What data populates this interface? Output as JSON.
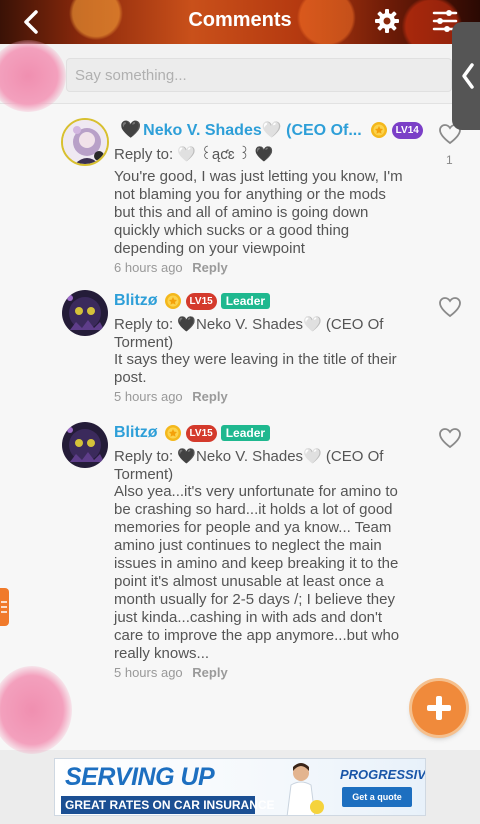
{
  "header": {
    "title": "Comments"
  },
  "composer": {
    "placeholder": "Say something..."
  },
  "comments": [
    {
      "author_prefix": "🖤",
      "author": "Neko V. Shades🤍 (CEO Of...",
      "level": "LV14",
      "reply_to": "Reply to: 🤍 ꒰ąƈɛ ꒱ 🖤",
      "text_lines": [
        "You're good, I was just letting you know, I'm",
        "not blaming you for anything or the mods",
        "but this and all of amino is going down",
        "quickly which sucks or a good thing",
        "depending on your viewpoint"
      ],
      "time": "6 hours ago",
      "reply_label": "Reply",
      "likes": "1"
    },
    {
      "author": "Blitzø",
      "level": "LV15",
      "role": "Leader",
      "reply_to_lines": [
        "Reply to: 🖤Neko V. Shades🤍 (CEO Of",
        "Torment)"
      ],
      "text_lines": [
        "It says they were leaving in the title of their",
        "post."
      ],
      "time": "5 hours ago",
      "reply_label": "Reply"
    },
    {
      "author": "Blitzø",
      "level": "LV15",
      "role": "Leader",
      "reply_to_lines": [
        "Reply to: 🖤Neko V. Shades🤍 (CEO Of",
        "Torment)"
      ],
      "text_lines": [
        "Also yea...it's very unfortunate for amino to",
        "be crashing so hard...it holds a lot of good",
        "memories for people and ya know... Team",
        "amino just continues to neglect the main",
        "issues in amino and keep breaking it to the",
        "point it's almost unusable at least once a",
        "month usually for 2-5 days /; I believe they",
        "just kinda...cashing in with ads and don't",
        "care to improve the app anymore...but who",
        "really knows..."
      ],
      "time": "5 hours ago",
      "reply_label": "Reply"
    }
  ],
  "ad": {
    "headline": "SERVING UP",
    "subline": "GREAT RATES ON CAR INSURANCE",
    "brand": "PROGRESSIVE",
    "cta": "Get a quote"
  },
  "colors": {
    "name_blue": "#2e9fd8",
    "leader_green": "#1fb88f",
    "fab_orange": "#f08a3b"
  },
  "icons": [
    "back-chevron-icon",
    "gear-icon",
    "filter-sliders-icon",
    "heart-icon",
    "plus-icon",
    "gold-medal-icon"
  ]
}
